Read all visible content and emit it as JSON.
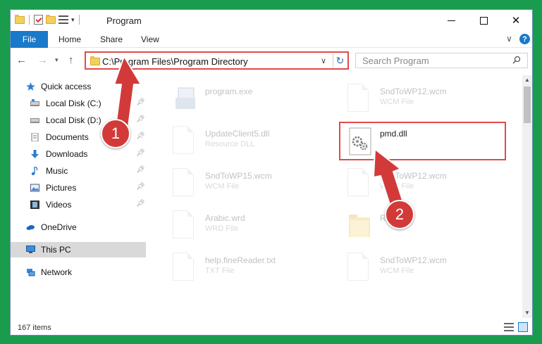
{
  "window": {
    "title": "Program"
  },
  "ribbon": {
    "file": "File",
    "home": "Home",
    "share": "Share",
    "view": "View"
  },
  "address": {
    "path": "C:\\Program Files\\Program Directory"
  },
  "search": {
    "placeholder": "Search Program"
  },
  "nav": {
    "items": [
      {
        "label": "Quick access",
        "icon": "star-icon"
      },
      {
        "label": "Local Disk (C:)",
        "icon": "drive-icon",
        "pinned": true
      },
      {
        "label": "Local Disk (D:)",
        "icon": "drive-icon",
        "pinned": true
      },
      {
        "label": "Documents",
        "icon": "documents-icon",
        "pinned": true
      },
      {
        "label": "Downloads",
        "icon": "download-icon",
        "pinned": true
      },
      {
        "label": "Music",
        "icon": "music-icon",
        "pinned": true
      },
      {
        "label": "Pictures",
        "icon": "pictures-icon",
        "pinned": true
      },
      {
        "label": "Videos",
        "icon": "videos-icon",
        "pinned": true
      },
      {
        "label": "OneDrive",
        "icon": "cloud-icon"
      },
      {
        "label": "This PC",
        "icon": "monitor-icon",
        "selected": true
      },
      {
        "label": "Network",
        "icon": "network-icon"
      }
    ]
  },
  "files": [
    {
      "name": "program.exe",
      "type": ""
    },
    {
      "name": "SndToWP12.wcm",
      "type": "WCM File"
    },
    {
      "name": "UpdateClient5.dll",
      "type": "Resource DLL"
    },
    {
      "name": "pmd.dll",
      "type": ""
    },
    {
      "name": "SndToWP15.wcm",
      "type": "WCM File"
    },
    {
      "name": "SndToWP12.wcm",
      "type": "WCM File"
    },
    {
      "name": "Arabic.wrd",
      "type": "WRD File"
    },
    {
      "name": "Res",
      "type": ""
    },
    {
      "name": "help.fineReader.txt",
      "type": "TXT File"
    },
    {
      "name": "SndToWP12.wcm",
      "type": "WCM File"
    }
  ],
  "status": {
    "count": "167 items"
  },
  "annotations": {
    "step1": "1",
    "step2": "2"
  },
  "colors": {
    "background": "#1a9c4e",
    "accent": "#1979ca",
    "highlight": "#e24a4a"
  }
}
